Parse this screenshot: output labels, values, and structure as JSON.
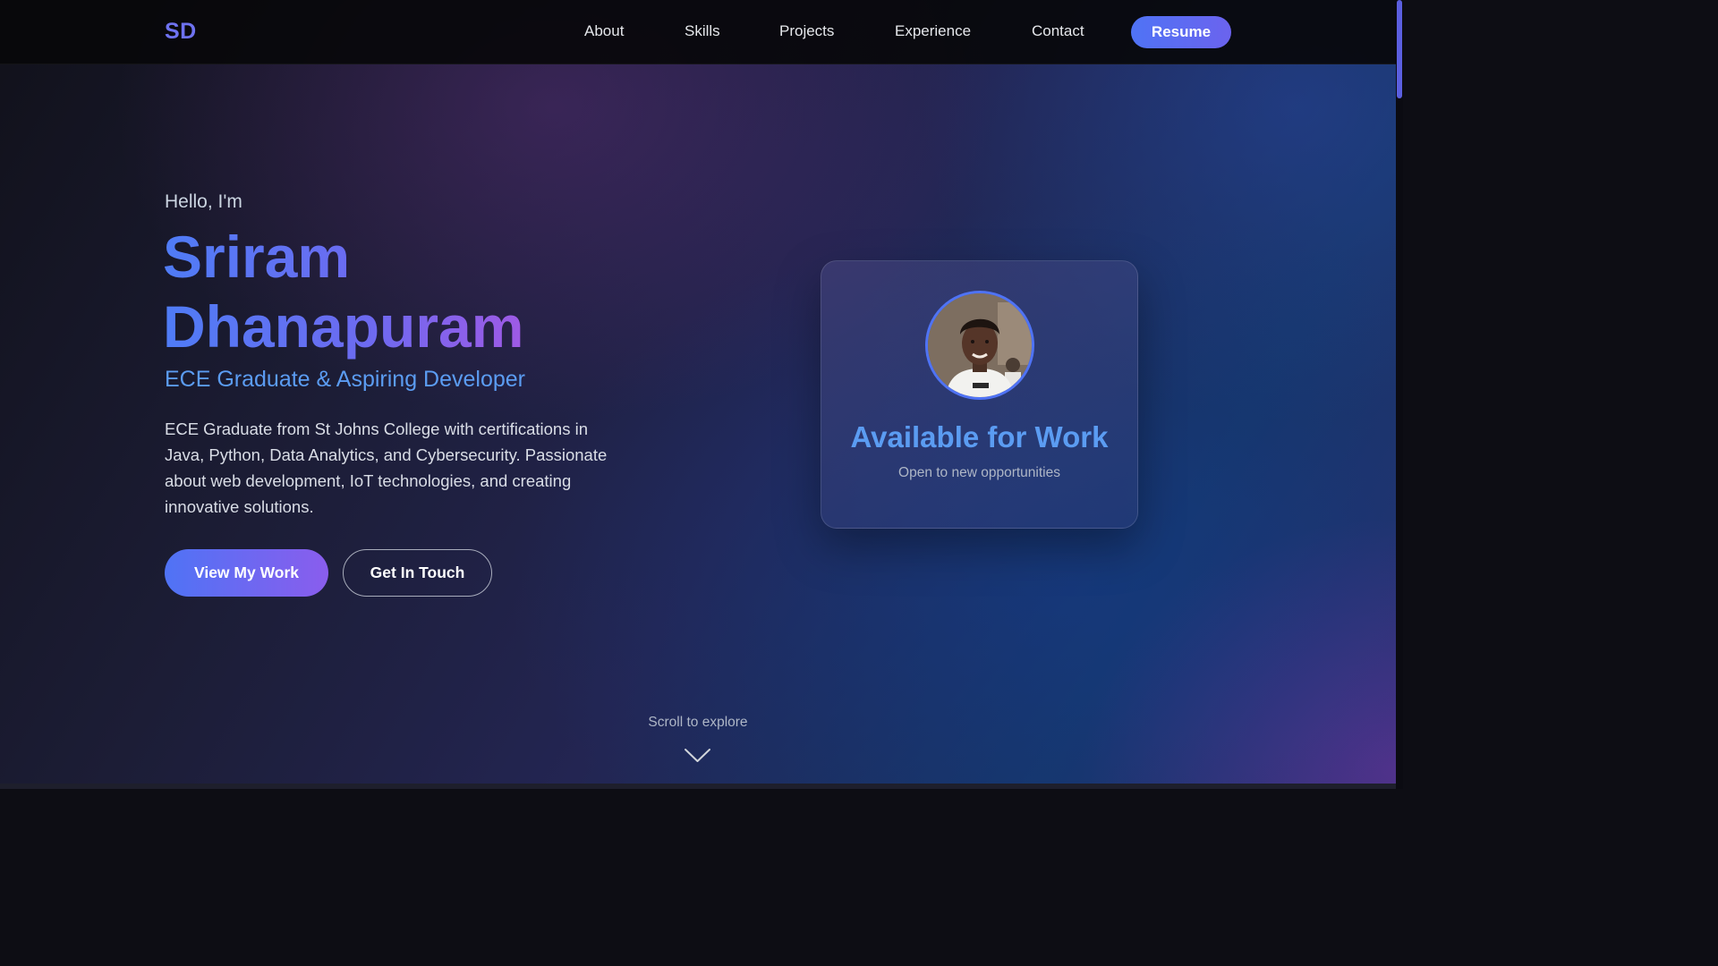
{
  "header": {
    "logo": "SD",
    "nav": [
      {
        "label": "About"
      },
      {
        "label": "Skills"
      },
      {
        "label": "Projects"
      },
      {
        "label": "Experience"
      },
      {
        "label": "Contact"
      }
    ],
    "resume_label": "Resume"
  },
  "hero": {
    "greeting": "Hello, I'm",
    "name_line1": "Sriram",
    "name_line2": "Dhanapuram",
    "subtitle": "ECE Graduate & Aspiring Developer",
    "bio": "ECE Graduate from St Johns College with certifications in Java, Python, Data Analytics, and Cybersecurity. Passionate about web development, IoT technologies, and creating innovative solutions.",
    "primary_button": "View My Work",
    "secondary_button": "Get In Touch"
  },
  "status_card": {
    "title": "Available for Work",
    "subtitle": "Open to new opportunities",
    "avatar_icon": "profile-photo"
  },
  "scroll_hint": {
    "text": "Scroll to explore",
    "icon": "chevron-down-icon"
  },
  "colors": {
    "accent_blue": "#4f73f5",
    "accent_purple": "#8a5ded",
    "highlight_blue": "#5b9cf2",
    "name_gradient_end": "#c556d9"
  }
}
